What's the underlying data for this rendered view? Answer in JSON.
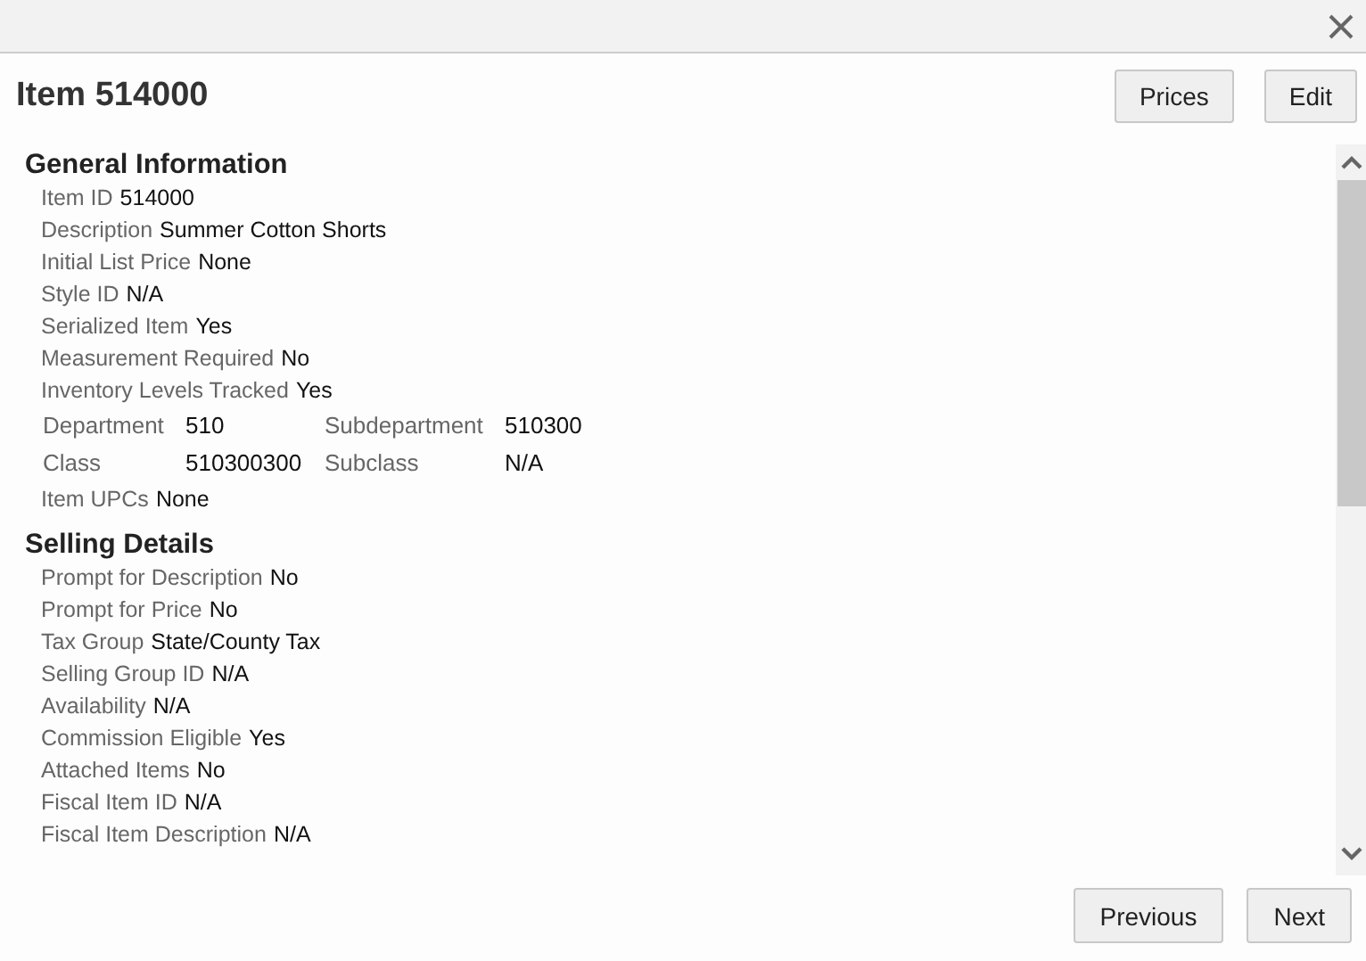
{
  "title": "Item 514000",
  "header_buttons": [
    "Prices",
    "Edit"
  ],
  "sections": [
    {
      "title": "General Information",
      "rows": [
        {
          "kind": "field",
          "label": "Item ID",
          "value": "514000"
        },
        {
          "kind": "field",
          "label": "Description",
          "value": "Summer Cotton Shorts"
        },
        {
          "kind": "field",
          "label": "Initial List Price",
          "value": "None"
        },
        {
          "kind": "field",
          "label": "Style ID",
          "value": "N/A"
        },
        {
          "kind": "field",
          "label": "Serialized Item",
          "value": "Yes"
        },
        {
          "kind": "field",
          "label": "Measurement Required",
          "value": "No"
        },
        {
          "kind": "field",
          "label": "Inventory Levels Tracked",
          "value": "Yes"
        },
        {
          "kind": "grid",
          "cells": [
            {
              "label": "Department",
              "value": "510"
            },
            {
              "label": "Subdepartment",
              "value": "510300"
            }
          ]
        },
        {
          "kind": "grid",
          "cells": [
            {
              "label": "Class",
              "value": "510300300"
            },
            {
              "label": "Subclass",
              "value": "N/A"
            }
          ]
        },
        {
          "kind": "field",
          "label": "Item UPCs",
          "value": "None"
        }
      ]
    },
    {
      "title": "Selling Details",
      "rows": [
        {
          "kind": "field",
          "label": "Prompt for Description",
          "value": "No"
        },
        {
          "kind": "field",
          "label": "Prompt for Price",
          "value": "No"
        },
        {
          "kind": "field",
          "label": "Tax Group",
          "value": "State/County Tax"
        },
        {
          "kind": "field",
          "label": "Selling Group ID",
          "value": "N/A"
        },
        {
          "kind": "field",
          "label": "Availability",
          "value": "N/A"
        },
        {
          "kind": "field",
          "label": "Commission Eligible",
          "value": "Yes"
        },
        {
          "kind": "field",
          "label": "Attached Items",
          "value": "No"
        },
        {
          "kind": "field",
          "label": "Fiscal Item ID",
          "value": "N/A"
        },
        {
          "kind": "field",
          "label": "Fiscal Item Description",
          "value": "N/A"
        }
      ]
    }
  ],
  "footer_buttons": [
    "Previous",
    "Next"
  ]
}
